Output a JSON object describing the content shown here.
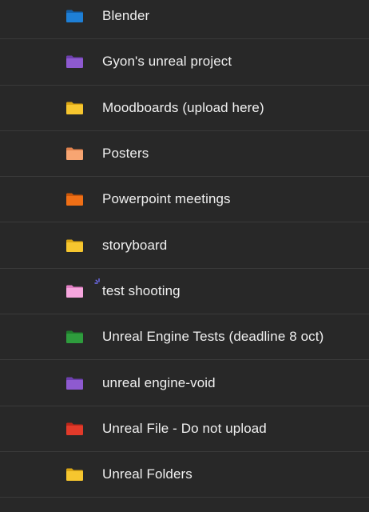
{
  "folders": [
    {
      "label": "Blender",
      "color": "#1e7fd6",
      "tab": "#135fa8"
    },
    {
      "label": "Gyon's unreal project",
      "color": "#8e5ad0",
      "tab": "#6d3fae"
    },
    {
      "label": "Moodboards (upload here)",
      "color": "#f6c62f",
      "tab": "#d9a514"
    },
    {
      "label": "Posters",
      "color": "#f7a572",
      "tab": "#e0824d"
    },
    {
      "label": "Powerpoint meetings",
      "color": "#ef6f16",
      "tab": "#c9560a"
    },
    {
      "label": "storyboard",
      "color": "#f6c62f",
      "tab": "#d9a514"
    },
    {
      "label": "test shooting",
      "color": "#f6a6de",
      "tab": "#e27fc5",
      "sparkle": true
    },
    {
      "label": "Unreal Engine Tests (deadline 8 oct)",
      "color": "#2e9c3d",
      "tab": "#1f7a2c"
    },
    {
      "label": "unreal engine-void",
      "color": "#8e5ad0",
      "tab": "#6d3fae"
    },
    {
      "label": "Unreal File - Do not upload",
      "color": "#e23a2a",
      "tab": "#b9271a"
    },
    {
      "label": "Unreal Folders",
      "color": "#f6c62f",
      "tab": "#d9a514"
    }
  ],
  "icons": {
    "folder": "folder-icon",
    "sparkle": "sparkle-icon"
  }
}
